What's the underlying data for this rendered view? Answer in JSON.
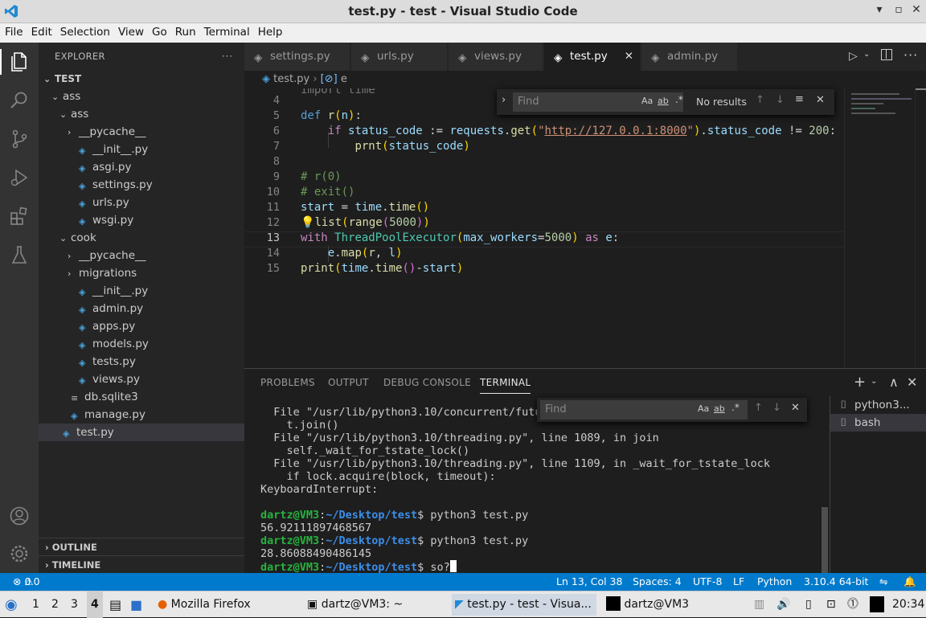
{
  "window": {
    "title": "test.py - test - Visual Studio Code"
  },
  "menu": [
    "File",
    "Edit",
    "Selection",
    "View",
    "Go",
    "Run",
    "Terminal",
    "Help"
  ],
  "explorer": {
    "header": "EXPLORER",
    "more": "···",
    "root": "TEST",
    "items": [
      {
        "label": "ass",
        "kind": "folder-open"
      },
      {
        "label": "ass",
        "kind": "folder-open"
      },
      {
        "label": "__pycache__",
        "kind": "folder"
      },
      {
        "label": "__init__.py",
        "kind": "py"
      },
      {
        "label": "asgi.py",
        "kind": "py"
      },
      {
        "label": "settings.py",
        "kind": "py"
      },
      {
        "label": "urls.py",
        "kind": "py"
      },
      {
        "label": "wsgi.py",
        "kind": "py"
      },
      {
        "label": "cook",
        "kind": "folder-open"
      },
      {
        "label": "__pycache__",
        "kind": "folder"
      },
      {
        "label": "migrations",
        "kind": "folder"
      },
      {
        "label": "__init__.py",
        "kind": "py"
      },
      {
        "label": "admin.py",
        "kind": "py"
      },
      {
        "label": "apps.py",
        "kind": "py"
      },
      {
        "label": "models.py",
        "kind": "py"
      },
      {
        "label": "tests.py",
        "kind": "py"
      },
      {
        "label": "views.py",
        "kind": "py"
      },
      {
        "label": "db.sqlite3",
        "kind": "db"
      },
      {
        "label": "manage.py",
        "kind": "py"
      },
      {
        "label": "test.py",
        "kind": "py"
      }
    ],
    "outline": "OUTLINE",
    "timeline": "TIMELINE"
  },
  "tabs": [
    {
      "label": "settings.py",
      "active": false
    },
    {
      "label": "urls.py",
      "active": false
    },
    {
      "label": "views.py",
      "active": false
    },
    {
      "label": "test.py",
      "active": true
    },
    {
      "label": "admin.py",
      "active": false
    }
  ],
  "breadcrumb": {
    "file": "test.py",
    "symbol": "e"
  },
  "find_widget": {
    "placeholder": "Find",
    "result": "No results",
    "opt_case": "Aa",
    "opt_word": "ab",
    "opt_regex": ".*"
  },
  "editor": {
    "line_numbers": [
      "4",
      "5",
      "6",
      "7",
      "8",
      "9",
      "10",
      "11",
      "12",
      "13",
      "14",
      "15"
    ],
    "partial_line": "import time",
    "current_line": "13"
  },
  "panel": {
    "tabs": [
      "PROBLEMS",
      "OUTPUT",
      "DEBUG CONSOLE",
      "TERMINAL"
    ],
    "active_tab": "TERMINAL",
    "find_placeholder": "Find",
    "terminal_lines": [
      "  File \"/usr/lib/python3.10/concurrent/futu",
      "    t.join()",
      "  File \"/usr/lib/python3.10/threading.py\", line 1089, in join",
      "    self._wait_for_tstate_lock()",
      "  File \"/usr/lib/python3.10/threading.py\", line 1109, in _wait_for_tstate_lock",
      "    if lock.acquire(block, timeout):",
      "KeyboardInterrupt:",
      ""
    ],
    "prompt_user": "dartz@VM3",
    "prompt_path": "~/Desktop/test",
    "cmd1": " python3 test.py",
    "out1": "56.92111897468567",
    "cmd2": " python3 test.py",
    "out2": "28.86088490486145",
    "cmd3": " so?",
    "terminals": [
      "python3...",
      "bash"
    ]
  },
  "status": {
    "errors": "0",
    "warnings": "0",
    "position": "Ln 13, Col 38",
    "spaces": "Spaces: 4",
    "encoding": "UTF-8",
    "eol": "LF",
    "language": "Python",
    "interpreter": "3.10.4 64-bit"
  },
  "taskbar": {
    "workspaces": [
      "1",
      "2",
      "3",
      "4"
    ],
    "apps": [
      "Mozilla Firefox",
      "dartz@VM3: ~",
      "test.py - test - Visua...",
      "dartz@VM3"
    ],
    "clock": "20:34"
  },
  "colors": {
    "accent": "#007acc",
    "activity": "#333333",
    "sidebar": "#252526",
    "editor": "#1e1e1e"
  }
}
